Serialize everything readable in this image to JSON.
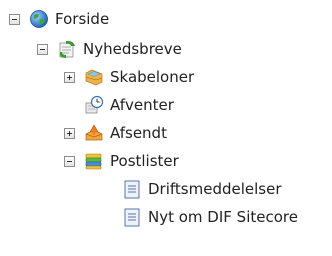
{
  "tree": {
    "root": {
      "label": "Forside",
      "icon": "globe-icon",
      "expanded": true
    },
    "nyhedsbreve": {
      "label": "Nyhedsbreve",
      "icon": "newsletter-icon",
      "expanded": true
    },
    "skabeloner": {
      "label": "Skabeloner",
      "icon": "template-folder-icon",
      "expanded": false
    },
    "afventer": {
      "label": "Afventer",
      "icon": "pending-clock-icon"
    },
    "afsendt": {
      "label": "Afsendt",
      "icon": "sent-outbox-icon",
      "expanded": false
    },
    "postlister": {
      "label": "Postlister",
      "icon": "mailing-list-icon",
      "expanded": true
    },
    "driftsmeddelelser": {
      "label": "Driftsmeddelelser",
      "icon": "document-icon"
    },
    "nyt_om_dif": {
      "label": "Nyt om DIF Sitecore",
      "icon": "document-icon"
    }
  }
}
